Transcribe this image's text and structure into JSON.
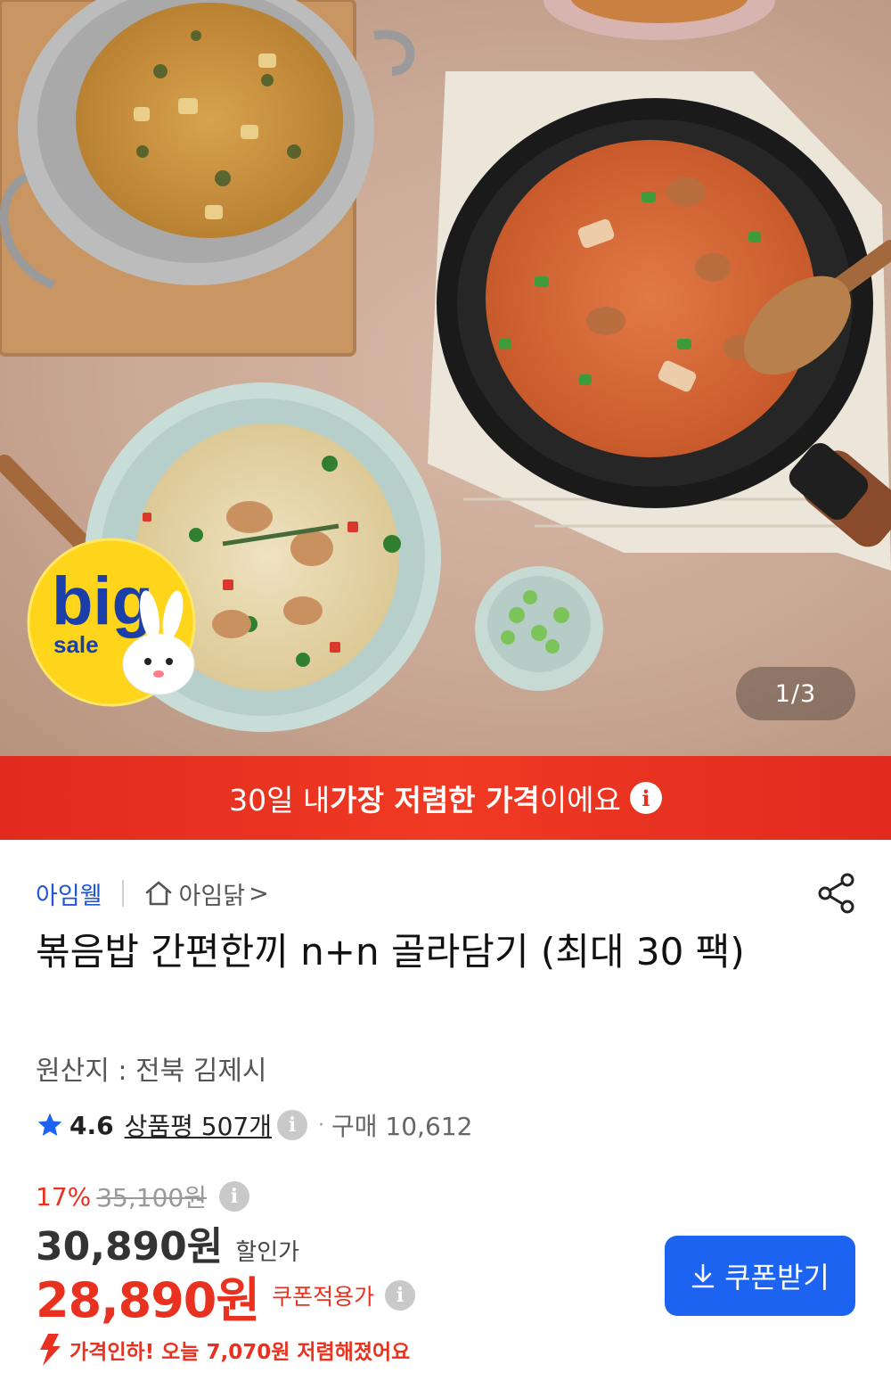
{
  "hero": {
    "badge_big": "big",
    "badge_sale": "sale",
    "page_indicator": "1/3"
  },
  "banner": {
    "text_prefix": "30일 내 ",
    "text_bold": "가장 저렴한 가격",
    "text_suffix": "이에요",
    "info_glyph": "i",
    "color": "#e8311f"
  },
  "brand": {
    "name": "아임웰",
    "store_name": "아임닭",
    "store_chevron": ">",
    "brand_color": "#1f55d6",
    "store_icon": "home-icon",
    "share_icon": "share-icon"
  },
  "product": {
    "title": "볶음밥 간편한끼 n+n 골라담기 (최대 30 팩)",
    "origin": "원산지 : 전북 김제시"
  },
  "rating": {
    "star_icon": "star-icon",
    "score": "4.6",
    "review_text": "상품평 507개",
    "info_glyph": "i",
    "separator": "·",
    "purchase_text": "구매 10,612"
  },
  "pricing": {
    "discount_rate": "17%",
    "original_price": "35,100원",
    "sale_price": "30,890원",
    "sale_label": "할인가",
    "coupon_price": "28,890원",
    "coupon_label": "쿠폰적용가",
    "info_glyph": "i",
    "drop_message": "가격인하! 오늘 7,070원 저렴해졌어요",
    "accent_color": "#e8311f"
  },
  "coupon_button": {
    "label": "쿠폰받기",
    "icon": "download-icon",
    "color": "#1b63f0"
  }
}
